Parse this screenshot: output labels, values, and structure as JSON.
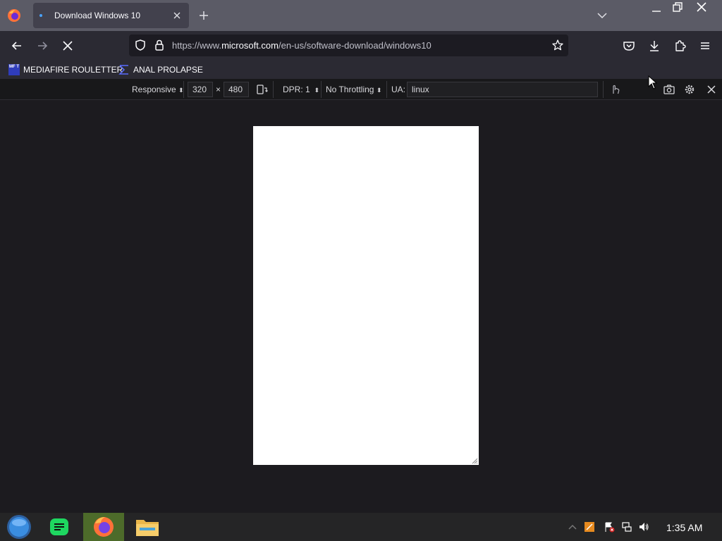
{
  "browser": {
    "tab": {
      "title": "Download Windows 10"
    },
    "url": {
      "prefix": "https://www.",
      "host": "microsoft.com",
      "path": "/en-us/software-download/windows10"
    }
  },
  "bookmarks": [
    {
      "label": "MEDIAFIRE ROULETTER",
      "icon_text": "MF T"
    },
    {
      "label": "ANAL PROLAPSE"
    }
  ],
  "rdm": {
    "device": "Responsive",
    "width": "320",
    "times": "×",
    "height": "480",
    "dpr": "DPR: 1",
    "throttling": "No Throttling",
    "ua_label": "UA:",
    "ua_value": "linux"
  },
  "taskbar": {
    "clock": "1:35 AM"
  },
  "colors": {
    "tabstrip": "#5b5b66",
    "tab_active": "#42414d",
    "toolbar": "#2b2a33",
    "taskbar_active": "#4d6b2a"
  }
}
